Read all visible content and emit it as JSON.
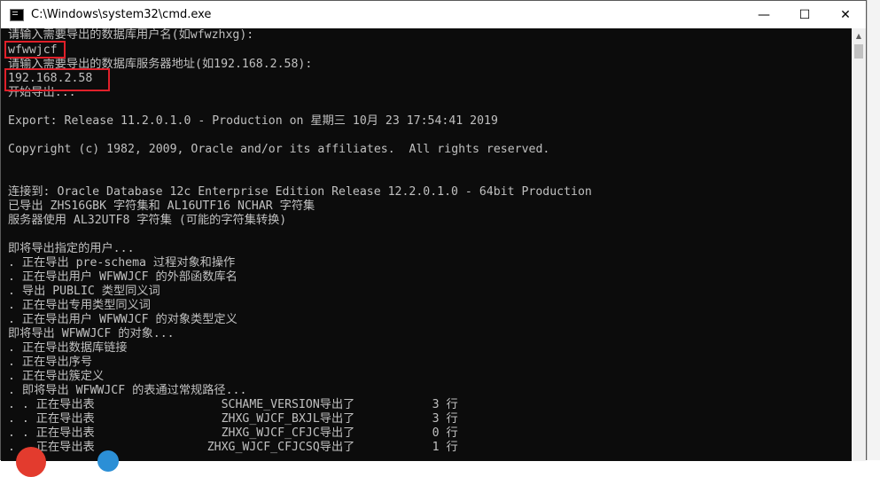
{
  "window": {
    "title": "C:\\Windows\\system32\\cmd.exe",
    "controls": {
      "minimize": "—",
      "maximize": "☐",
      "close": "✕"
    }
  },
  "console": {
    "lines": [
      "请输入需要导出的数据库用户名(如wfwzhxg):",
      "wfwwjcf",
      "请输入需要导出的数据库服务器地址(如192.168.2.58):",
      "192.168.2.58",
      "开始导出...",
      "",
      "Export: Release 11.2.0.1.0 - Production on 星期三 10月 23 17:54:41 2019",
      "",
      "Copyright (c) 1982, 2009, Oracle and/or its affiliates.  All rights reserved.",
      "",
      "",
      "连接到: Oracle Database 12c Enterprise Edition Release 12.2.0.1.0 - 64bit Production",
      "已导出 ZHS16GBK 字符集和 AL16UTF16 NCHAR 字符集",
      "服务器使用 AL32UTF8 字符集 (可能的字符集转换)",
      "",
      "即将导出指定的用户...",
      ". 正在导出 pre-schema 过程对象和操作",
      ". 正在导出用户 WFWWJCF 的外部函数库名",
      ". 导出 PUBLIC 类型同义词",
      ". 正在导出专用类型同义词",
      ". 正在导出用户 WFWWJCF 的对象类型定义",
      "即将导出 WFWWJCF 的对象...",
      ". 正在导出数据库链接",
      ". 正在导出序号",
      ". 正在导出簇定义",
      ". 即将导出 WFWWJCF 的表通过常规路径...",
      ". . 正在导出表                  SCHAME_VERSION导出了           3 行",
      ". . 正在导出表                  ZHXG_WJCF_BXJL导出了           3 行",
      ". . 正在导出表                  ZHXG_WJCF_CFJC导出了           0 行",
      ". . 正在导出表                ZHXG_WJCF_CFJCSQ导出了           1 行"
    ]
  }
}
